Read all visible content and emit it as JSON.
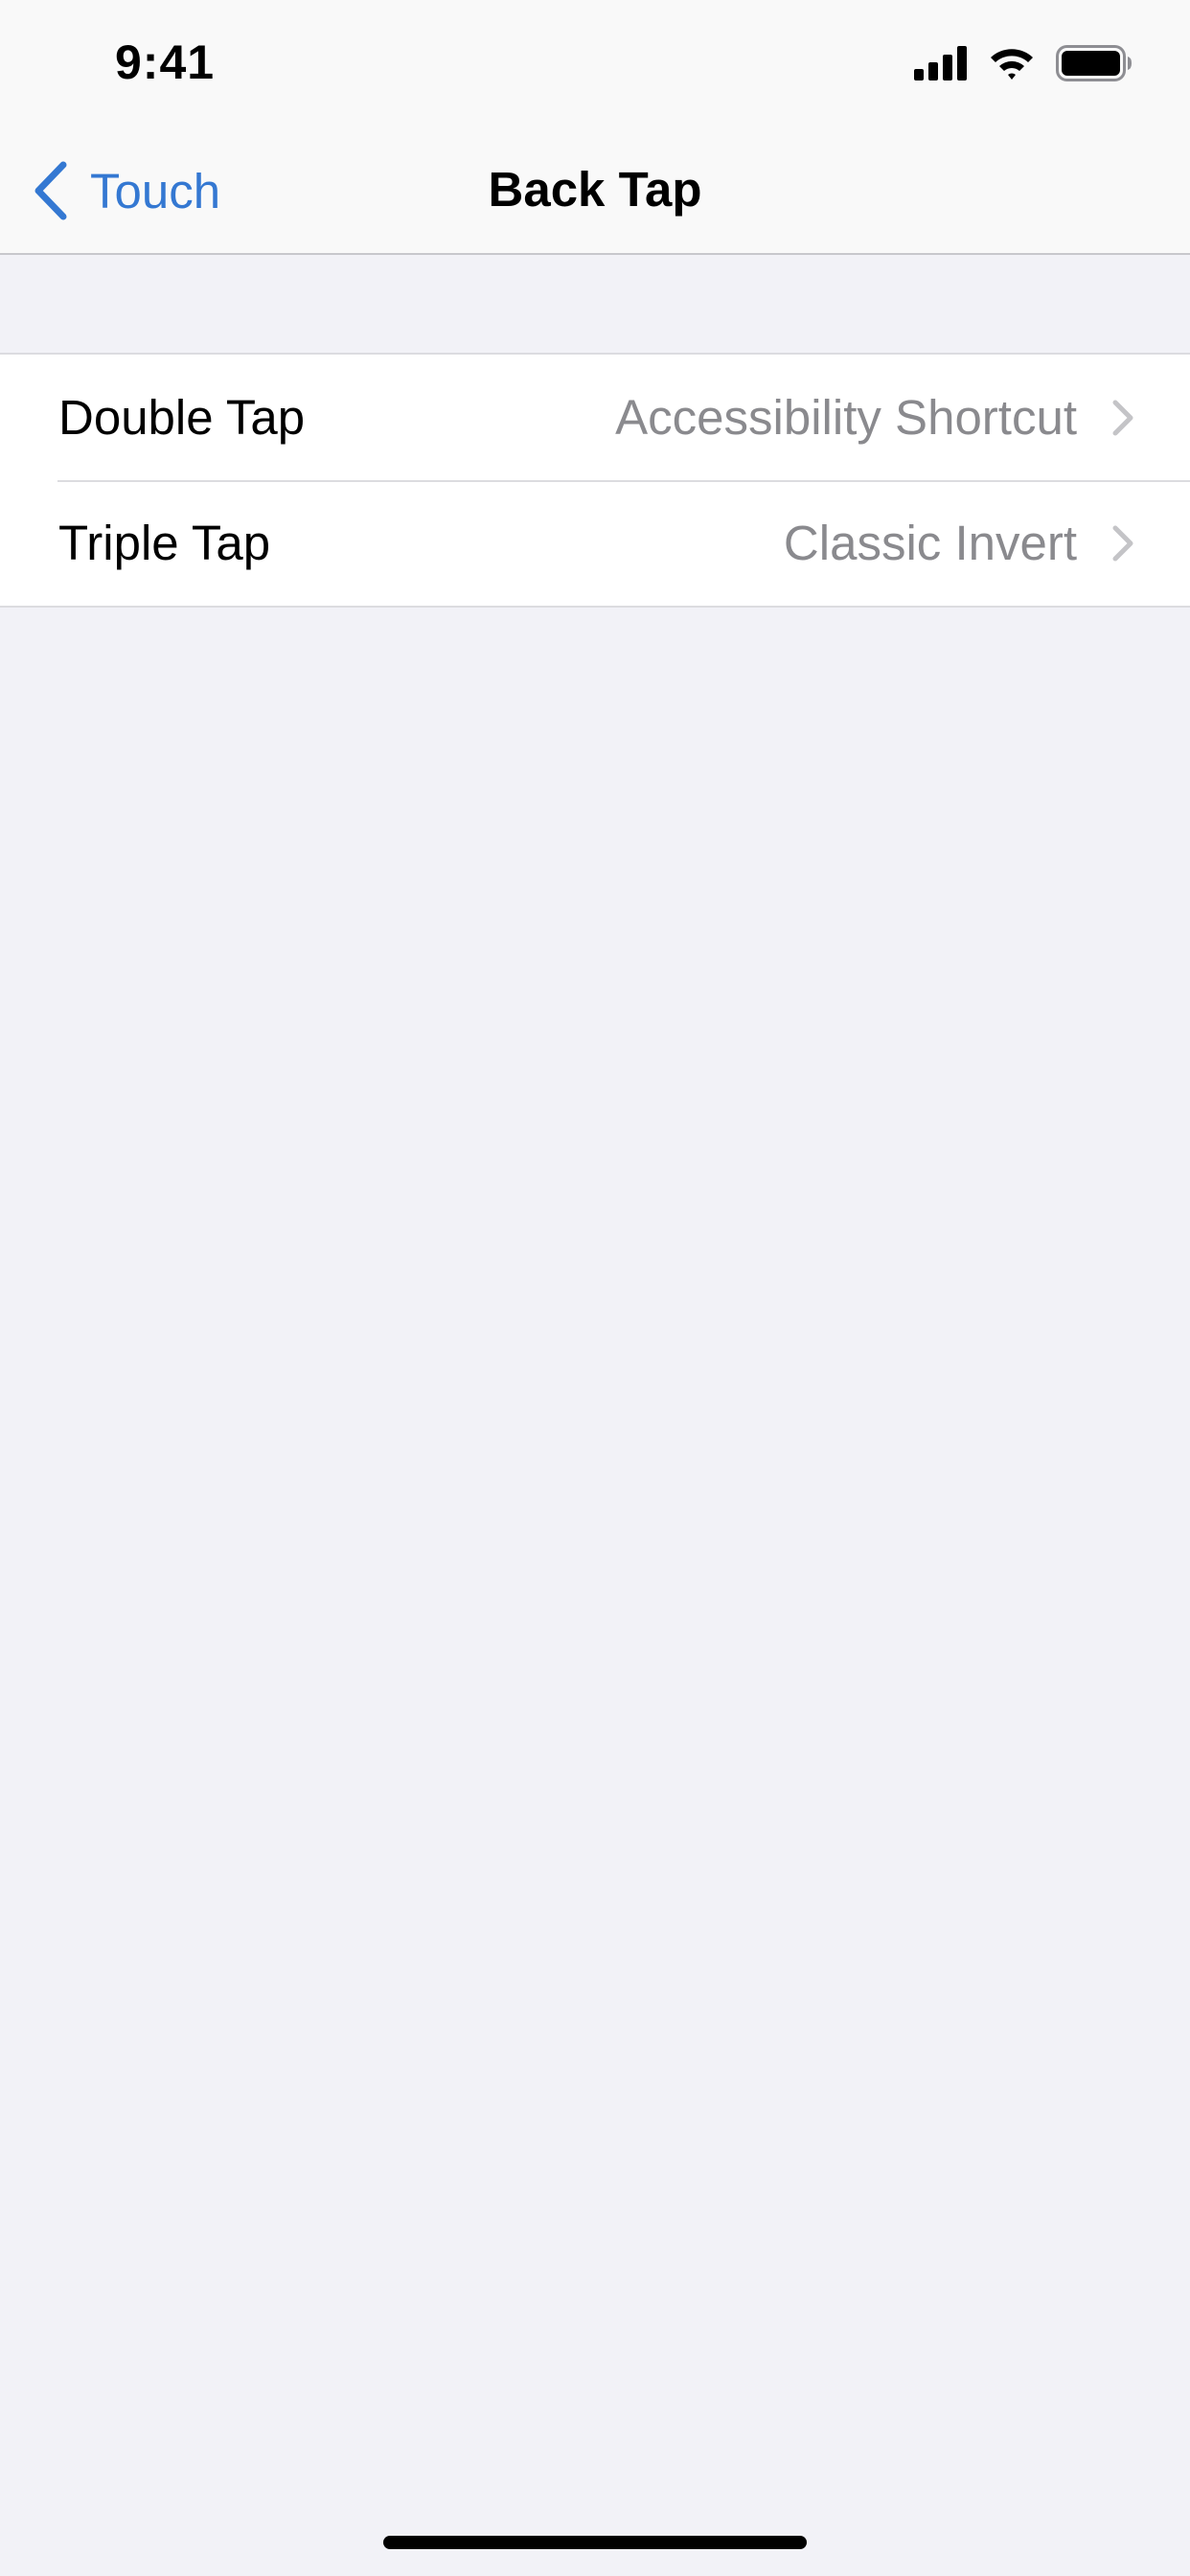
{
  "status_bar": {
    "time": "9:41",
    "icons": [
      "cellular-signal-icon",
      "wifi-icon",
      "battery-icon"
    ]
  },
  "nav": {
    "back_label": "Touch",
    "title": "Back Tap",
    "back_icon": "chevron-left-icon"
  },
  "settings": {
    "rows": [
      {
        "label": "Double Tap",
        "value": "Accessibility Shortcut"
      },
      {
        "label": "Triple Tap",
        "value": "Classic Invert"
      }
    ]
  },
  "colors": {
    "accent": "#3478D2",
    "background": "#F2F2F7",
    "secondary_text": "#8A8A8E",
    "separator": "#DCDCE0",
    "chevron": "#C4C4C7"
  }
}
